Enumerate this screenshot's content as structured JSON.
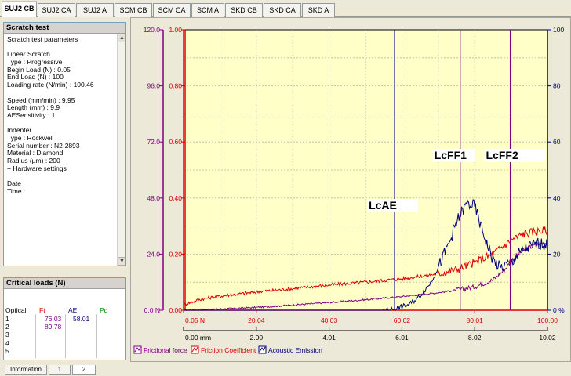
{
  "tabs": [
    "SUJ2 CB",
    "SUJ2 CA",
    "SUJ2 A",
    "SCM CB",
    "SCM CA",
    "SCM A",
    "SKD CB",
    "SKD CA",
    "SKD A"
  ],
  "active_tab": 0,
  "scratch_panel": {
    "title": "Scratch test",
    "lines": [
      "Scratch test parameters",
      "",
      "Linear Scratch",
      "Type : Progressive",
      "Begin Load (N) : 0.05",
      "End Load (N) : 100",
      "Loading rate (N/min) : 100.46",
      "",
      "Speed (mm/min) : 9.95",
      "Length (mm) : 9.9",
      "AESensitivity : 1",
      "",
      "Indenter",
      "Type : Rockwell",
      "Serial number : N2-2893",
      "Material : Diamond",
      "Radius (µm) : 200",
      "+ Hardware settings",
      "",
      "Date :",
      "Time :"
    ]
  },
  "critical_loads": {
    "title": "Critical loads (N)",
    "headers": [
      "Optical",
      "Ft",
      "AE",
      "Pd"
    ],
    "header_colors": [
      "#000000",
      "#cc0000",
      "#00008b",
      "#008000"
    ],
    "rows": [
      {
        "n": "1",
        "ft": "76.03",
        "ae": "58.01",
        "pd": ""
      },
      {
        "n": "2",
        "ft": "89.78",
        "ae": "",
        "pd": ""
      },
      {
        "n": "3",
        "ft": "",
        "ae": "",
        "pd": ""
      },
      {
        "n": "4",
        "ft": "",
        "ae": "",
        "pd": ""
      },
      {
        "n": "5",
        "ft": "",
        "ae": "",
        "pd": ""
      }
    ]
  },
  "bottom_tabs": [
    "Information",
    "1",
    "2"
  ],
  "chart_data": {
    "type": "line",
    "x_load": {
      "ticks": [
        "0.05 N",
        "20.04",
        "40.03",
        "60.02",
        "80.01",
        "100.00"
      ],
      "range": [
        0.05,
        100.0
      ]
    },
    "x_length": {
      "ticks": [
        "0.00 mm",
        "2.00",
        "4.01",
        "6.01",
        "8.02",
        "10.02"
      ],
      "range": [
        0.0,
        10.02
      ]
    },
    "y_frictional_force": {
      "ticks": [
        "0.0 N",
        "24.0",
        "48.0",
        "72.0",
        "96.0",
        "120.0"
      ],
      "range": [
        0,
        120
      ],
      "color": "#800080"
    },
    "y_friction_coefficient": {
      "ticks": [
        "0.00",
        "0.20",
        "0.40",
        "0.60",
        "0.80",
        "1.00"
      ],
      "range": [
        0,
        1
      ],
      "color": "#dd0000"
    },
    "y_acoustic_emission": {
      "ticks": [
        "0 %",
        "20",
        "40",
        "60",
        "80",
        "100"
      ],
      "range": [
        0,
        100
      ],
      "color": "#000080"
    },
    "grid": true,
    "legend_placement": "bottom-left",
    "series": [
      {
        "name": "Frictional force",
        "color": "#800080",
        "points": [
          [
            0.05,
            0.0
          ],
          [
            10,
            0.5
          ],
          [
            20,
            1.2
          ],
          [
            30,
            2.2
          ],
          [
            40,
            3.3
          ],
          [
            50,
            4.5
          ],
          [
            60,
            5.8
          ],
          [
            70,
            7.5
          ],
          [
            75,
            8.6
          ],
          [
            80,
            10.0
          ],
          [
            85,
            13.0
          ],
          [
            88,
            17.0
          ],
          [
            90,
            21.0
          ],
          [
            92,
            24.0
          ],
          [
            94,
            26.0
          ],
          [
            96,
            27.5
          ],
          [
            98,
            28.5
          ],
          [
            100,
            29.0
          ]
        ]
      },
      {
        "name": "Friction Coefficient",
        "color": "#dd0000",
        "points": [
          [
            0.05,
            0.02
          ],
          [
            5,
            0.04
          ],
          [
            10,
            0.05
          ],
          [
            20,
            0.065
          ],
          [
            30,
            0.077
          ],
          [
            40,
            0.09
          ],
          [
            50,
            0.1
          ],
          [
            58,
            0.11
          ],
          [
            60,
            0.112
          ],
          [
            70,
            0.13
          ],
          [
            75,
            0.145
          ],
          [
            80,
            0.17
          ],
          [
            85,
            0.2
          ],
          [
            88,
            0.23
          ],
          [
            90,
            0.25
          ],
          [
            93,
            0.27
          ],
          [
            96,
            0.28
          ],
          [
            100,
            0.285
          ]
        ]
      },
      {
        "name": "Acoustic Emission",
        "color": "#000080",
        "points": [
          [
            0.05,
            0.0
          ],
          [
            55,
            0.0
          ],
          [
            58,
            0.5
          ],
          [
            62,
            2.0
          ],
          [
            65,
            5.0
          ],
          [
            68,
            10.0
          ],
          [
            71,
            18.0
          ],
          [
            73,
            24.0
          ],
          [
            75,
            31.0
          ],
          [
            76,
            34.0
          ],
          [
            78,
            38.0
          ],
          [
            80,
            37.0
          ],
          [
            81,
            33.0
          ],
          [
            83,
            25.0
          ],
          [
            85,
            18.0
          ],
          [
            87,
            15.0
          ],
          [
            90,
            17.0
          ],
          [
            92,
            20.0
          ],
          [
            94,
            22.0
          ],
          [
            96,
            23.0
          ],
          [
            98,
            24.0
          ],
          [
            100,
            23.0
          ]
        ]
      }
    ],
    "markers": [
      {
        "label": "LcAE",
        "x_load": 58.01,
        "color": "#000080"
      },
      {
        "label": "LcFF1",
        "x_load": 76.03,
        "color": "#800080"
      },
      {
        "label": "LcFF2",
        "x_load": 89.78,
        "color": "#800080"
      }
    ]
  }
}
